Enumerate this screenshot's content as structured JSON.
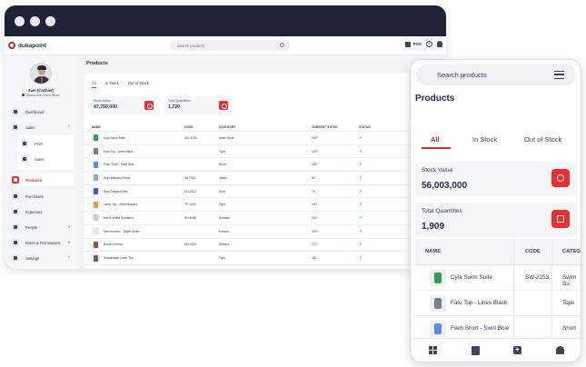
{
  "desktop": {
    "logo": "dukapoint",
    "search_placeholder": "Search products",
    "pos_label": "POS",
    "profile": {
      "name": "Sam (Cashier)",
      "store": "Awesome Cloth Store"
    },
    "nav": {
      "dashboard": "Dashboard",
      "sales": "Sales",
      "pos": "POS",
      "sales_sub": "Sales",
      "products": "Products",
      "purchases": "Purchases",
      "expenses": "Expenses",
      "people": "People",
      "roles": "Roles & Permissions",
      "settings": "Settings"
    },
    "page_title": "Products",
    "tabs": [
      "All",
      "In Stock",
      "Out of Stock"
    ],
    "stats": [
      {
        "label": "Stock Value",
        "value": "47,750,000"
      },
      {
        "label": "Total Quantities",
        "value": "1,720"
      }
    ],
    "columns": [
      "NAME",
      "CODE",
      "CATEGORY",
      "CURRENT STOCK",
      "STATUS"
    ],
    "rows": [
      {
        "name": "Cyla Swim Suite",
        "code": "SW-2253",
        "category": "Swim Suite",
        "stock": "200",
        "status": "✓"
      },
      {
        "name": "Fatu Top - Lines Black",
        "code": "",
        "category": "Tops",
        "stock": "120",
        "status": "✓"
      },
      {
        "name": "Fekh Short - Swirl Blue",
        "code": "",
        "category": "Short",
        "stock": "150",
        "status": "✓"
      },
      {
        "name": "High Waisted Jeans",
        "code": "JN-7012",
        "category": "Jeans",
        "stock": "80",
        "status": "✓"
      },
      {
        "name": "Blue Elegant Shirt",
        "code": "SH-3312",
        "category": "Shirt",
        "stock": "70",
        "status": "✓"
      },
      {
        "name": "Lamu Top - Swirl Mustard",
        "code": "TP-1431",
        "category": "Tops",
        "stock": "190",
        "status": "✓"
      },
      {
        "name": "Men's White Sneakers",
        "code": "SN-4058",
        "category": "Sneaker",
        "stock": "220",
        "status": "✓"
      },
      {
        "name": "Men Kimono - Stripe White",
        "code": "",
        "category": "Kimono",
        "stock": "200",
        "status": "✓"
      },
      {
        "name": "Brown Kimono",
        "code": "KM-3321",
        "category": "Kimono",
        "stock": "170",
        "status": "✓"
      },
      {
        "name": "Sustainable Lamu Top",
        "code": "",
        "category": "Tops",
        "stock": "160",
        "status": "✓"
      }
    ]
  },
  "mobile": {
    "search_placeholder": "Search products",
    "page_title": "Products",
    "tabs": [
      "All",
      "In Stock",
      "Out of Stock"
    ],
    "stats": [
      {
        "label": "Stock Value",
        "value": "56,003,000"
      },
      {
        "label": "Total Quantities",
        "value": "1,909"
      }
    ],
    "columns": [
      "NAME",
      "CODE",
      "CATEG"
    ],
    "rows": [
      {
        "name": "Cyla Swim Suite",
        "code": "SW-2253",
        "category": "Swim Su"
      },
      {
        "name": "Fatu Top - Lines Black",
        "code": "",
        "category": "Tops"
      },
      {
        "name": "Fekh Short - Swirl Blue",
        "code": "",
        "category": "Short"
      }
    ]
  },
  "colors": {
    "accent": "#d62b2b",
    "button_red": "#e8302e",
    "dark": "#1f2335",
    "ok": "#1f9d55"
  },
  "icons": [
    "search-icon",
    "register-icon",
    "plus-circle-icon",
    "bell-icon",
    "menu-icon",
    "grid-icon"
  ]
}
